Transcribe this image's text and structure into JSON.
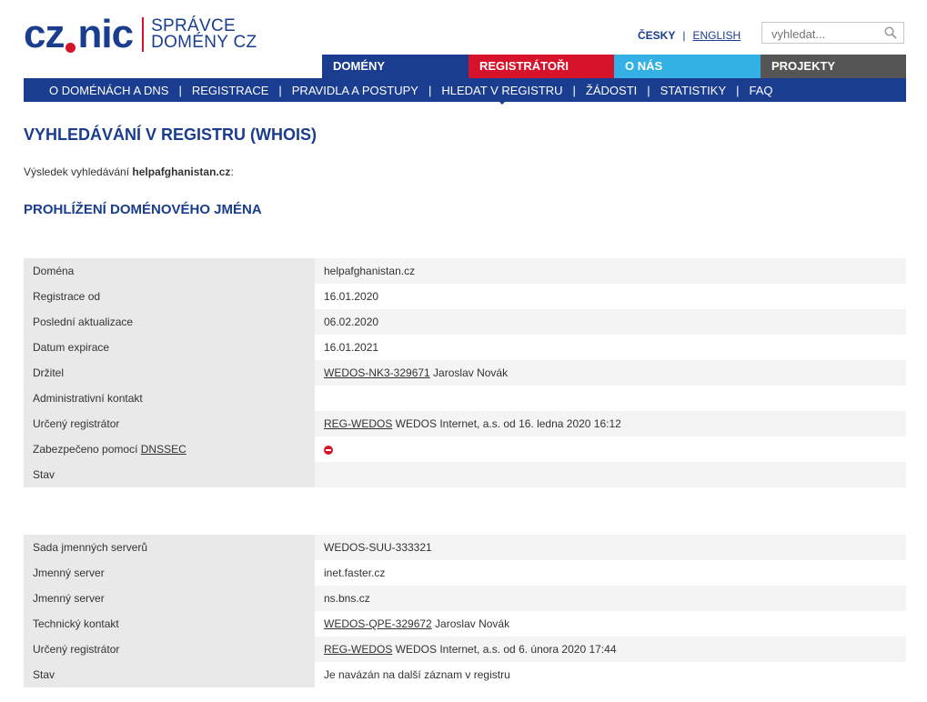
{
  "logo": {
    "brand_left": "cz",
    "brand_right": "nic",
    "sub_line1": "SPRÁVCE",
    "sub_line2": "DOMÉNY CZ"
  },
  "lang": {
    "czech": "ČESKY",
    "english": "ENGLISH"
  },
  "search": {
    "placeholder": "vyhledat..."
  },
  "topnav": [
    "DOMÉNY",
    "REGISTRÁTOŘI",
    "O NÁS",
    "PROJEKTY"
  ],
  "subnav": [
    "O DOMÉNÁCH A DNS",
    "REGISTRACE",
    "PRAVIDLA A POSTUPY",
    "HLEDAT V REGISTRU",
    "ŽÁDOSTI",
    "STATISTIKY",
    "FAQ"
  ],
  "page": {
    "title": "VYHLEDÁVÁNÍ V REGISTRU (WHOIS)",
    "result_prefix": "Výsledek vyhledávání ",
    "result_query": "helpafghanistan.cz",
    "result_suffix": ":",
    "section_title": "PROHLÍŽENÍ DOMÉNOVÉHO JMÉNA"
  },
  "domain_table": {
    "domena_label": "Doména",
    "domena_value": "helpafghanistan.cz",
    "reg_label": "Registrace od",
    "reg_value": "16.01.2020",
    "upd_label": "Poslední aktualizace",
    "upd_value": "06.02.2020",
    "exp_label": "Datum expirace",
    "exp_value": "16.01.2021",
    "holder_label": "Držitel",
    "holder_link": "WEDOS-NK3-329671",
    "holder_text": " Jaroslav Novák",
    "admin_label": "Administrativní kontakt",
    "registrar_label": "Určený registrátor",
    "registrar_link": "REG-WEDOS",
    "registrar_text": " WEDOS Internet, a.s. od 16. ledna 2020 16:12",
    "dnssec_label_prefix": "Zabezpečeno pomocí ",
    "dnssec_link": "DNSSEC",
    "status_label": "Stav"
  },
  "ns_table": {
    "set_label": "Sada jmenných serverů",
    "set_value": "WEDOS-SUU-333321",
    "ns1_label": "Jmenný server",
    "ns1_value": "inet.faster.cz",
    "ns2_label": "Jmenný server",
    "ns2_value": "ns.bns.cz",
    "tech_label": "Technický kontakt",
    "tech_link": "WEDOS-QPE-329672",
    "tech_text": " Jaroslav Novák",
    "registrar_label": "Určený registrátor",
    "registrar_link": "REG-WEDOS",
    "registrar_text": " WEDOS Internet, a.s. od 6. února 2020 17:44",
    "status_label": "Stav",
    "status_value": "Je navázán na další záznam v registru"
  },
  "icons": {
    "search": "magnifier-icon",
    "dnssec_status": "no-entry-icon"
  },
  "colors": {
    "brand_blue": "#1a3d8f",
    "brand_red": "#d6132a",
    "brand_cyan": "#34b1e4",
    "brand_gray": "#555555"
  }
}
